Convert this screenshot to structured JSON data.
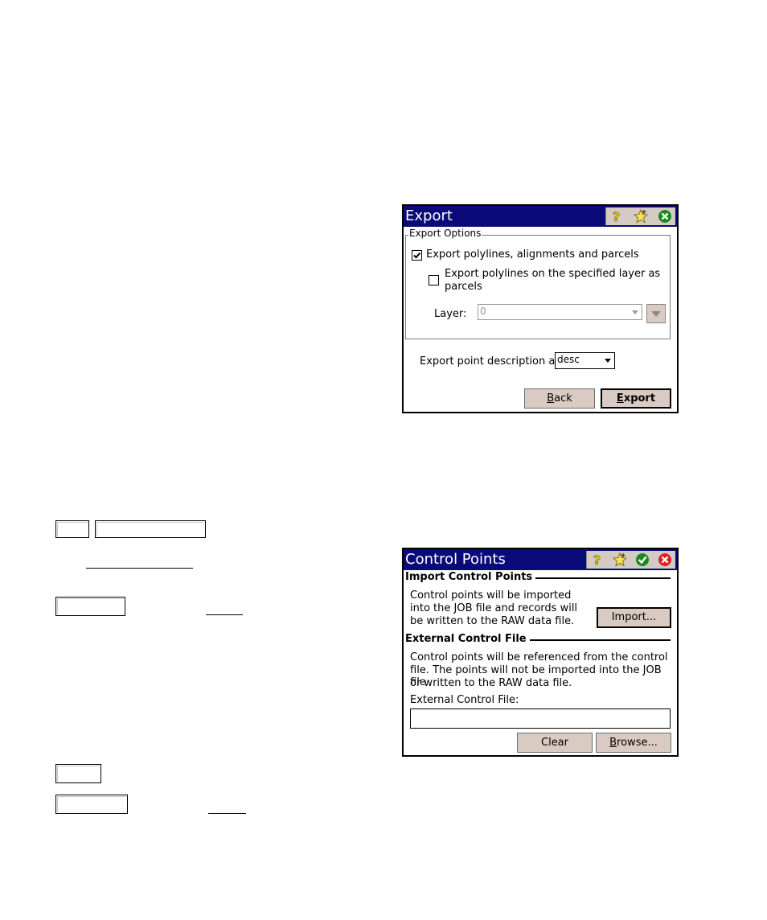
{
  "export_dialog": {
    "title": "Export",
    "group_label": "Export Options",
    "check_polylines_label": "Export polylines, alignments and parcels",
    "check_polylines_checked": true,
    "check_layer_parcels_label_line1": "Export polylines on the specified layer as",
    "check_layer_parcels_label_line2": "parcels",
    "check_layer_parcels_checked": false,
    "layer_label": "Layer:",
    "layer_value": "0",
    "point_desc_label": "Export point description as",
    "point_desc_value": "desc",
    "back_button": "Back",
    "export_button": "Export"
  },
  "control_points_dialog": {
    "title": "Control Points",
    "import_section_title": "Import Control Points",
    "import_desc_line1": "Control points will be imported",
    "import_desc_line2": "into the JOB file and records will",
    "import_desc_line3": "be written to the RAW data file.",
    "import_button": "Import...",
    "external_section_title": "External Control File",
    "external_desc_line1": "Control points will be referenced from the control",
    "external_desc_line2": "file. The points will not be imported into the JOB file",
    "external_desc_line3": "or written to the RAW data file.",
    "external_file_label": "External Control File:",
    "external_file_value": "",
    "clear_button": "Clear",
    "browse_button": "Browse..."
  },
  "icons": [
    "help-icon",
    "favorite-star-icon",
    "ok-check-icon",
    "close-x-icon",
    "dropdown-arrow-icon",
    "checkmark-icon"
  ],
  "colors": {
    "titlebar": "#0a0a7a",
    "button_face": "#d9cbc1",
    "ok_green": "#1a8a1a",
    "close_red": "#e02020",
    "help_yellow": "#e8d000"
  }
}
